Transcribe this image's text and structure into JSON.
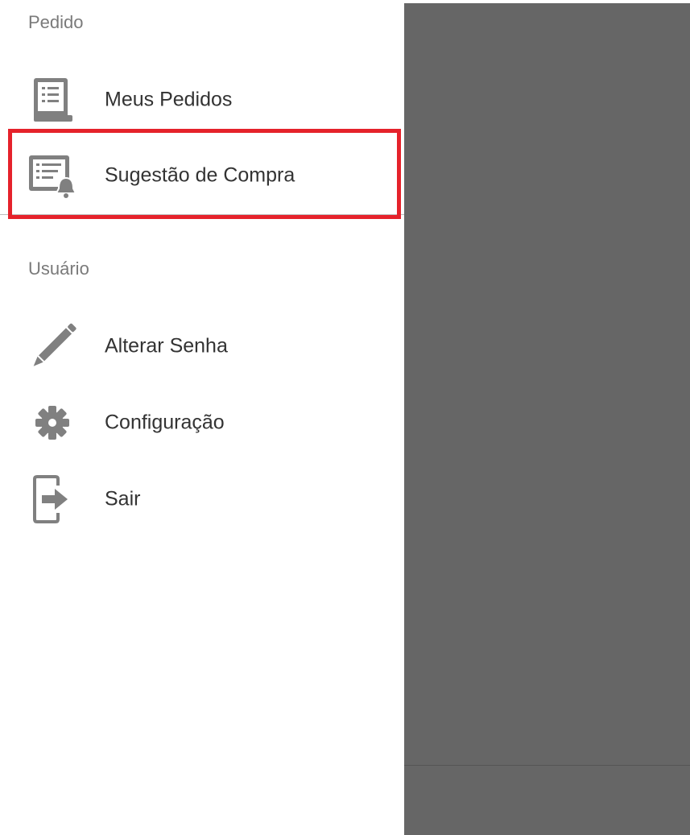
{
  "drawer": {
    "sections": [
      {
        "title": "Pedido",
        "items": [
          {
            "label": "Meus Pedidos",
            "icon": "order-list-icon"
          },
          {
            "label": "Sugestão de Compra",
            "icon": "purchase-suggestion-bell-icon"
          }
        ]
      },
      {
        "title": "Usuário",
        "items": [
          {
            "label": "Alterar Senha",
            "icon": "pencil-icon"
          },
          {
            "label": "Configuração",
            "icon": "gear-icon"
          },
          {
            "label": "Sair",
            "icon": "exit-icon"
          }
        ]
      }
    ]
  },
  "colors": {
    "icon": "#808080",
    "text": "#333333",
    "section_title": "#7a7a7a",
    "scrim": "#666666",
    "highlight_border": "#e5222b"
  }
}
